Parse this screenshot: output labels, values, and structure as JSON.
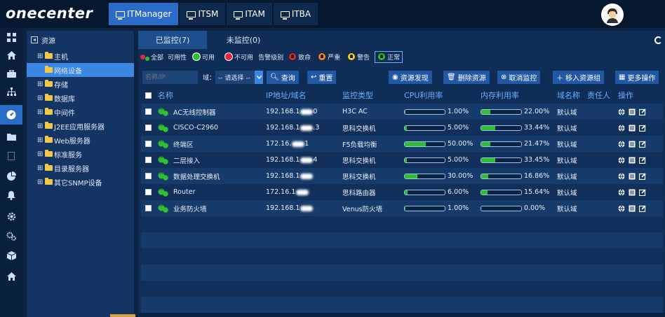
{
  "app": {
    "logo": "onecenter"
  },
  "topnav": [
    {
      "label": "ITManager",
      "active": true
    },
    {
      "label": "ITSM",
      "active": false
    },
    {
      "label": "ITAM",
      "active": false
    },
    {
      "label": "ITBA",
      "active": false
    }
  ],
  "rail_icons": [
    "grid-icon",
    "home-icon",
    "briefcase-icon",
    "hierarchy-icon",
    "gauge-icon",
    "folder-icon",
    "document-icon",
    "pie-chart-icon",
    "bell-icon",
    "gear-icon",
    "gears-icon",
    "cube-icon",
    "home-icon"
  ],
  "tree": {
    "root_label": "资源",
    "items": [
      {
        "label": "主机",
        "active": false
      },
      {
        "label": "网络设备",
        "active": true
      },
      {
        "label": "存储",
        "active": false
      },
      {
        "label": "数据库",
        "active": false
      },
      {
        "label": "中间件",
        "active": false
      },
      {
        "label": "J2EE应用服务器",
        "active": false
      },
      {
        "label": "Web服务器",
        "active": false
      },
      {
        "label": "标准服务",
        "active": false
      },
      {
        "label": "目录服务器",
        "active": false
      },
      {
        "label": "其它SNMP设备",
        "active": false
      }
    ]
  },
  "tabs": {
    "monitored": "已监控(7)",
    "unmonitored": "未监控(0)"
  },
  "legend": {
    "all": "全部",
    "availability": "可用性",
    "available": "可用",
    "unavailable": "不可用",
    "alarm_level": "告警级别",
    "fatal": "致命",
    "severe": "严重",
    "warning": "警告",
    "normal": "正常"
  },
  "toolbar": {
    "name_placeholder": "名称/IP",
    "domain_label": "域：",
    "domain_select": "-- 请选择 --",
    "query": "查询",
    "reset": "重置",
    "discover": "资源发现",
    "delete": "删除资源",
    "cancel_monitor": "取消监控",
    "move_group": "移入资源组",
    "more": "更多操作"
  },
  "table": {
    "headers": {
      "name": "名称",
      "ip": "IP地址/域名",
      "type": "监控类型",
      "cpu": "CPU利用率",
      "mem": "内存利用率",
      "domain": "域名称",
      "owner": "责任人",
      "ops": "操作"
    },
    "rows": [
      {
        "name": "AC无线控制器",
        "ip_prefix": "192.168.1",
        "ip_suffix": "0",
        "type": "H3C AC",
        "cpu": 1.0,
        "cpu_label": "1.00%",
        "mem": 22.0,
        "mem_label": "22.00%",
        "domain": "默认域"
      },
      {
        "name": "CISCO-C2960",
        "ip_prefix": "192.168.1",
        "ip_suffix": ".3",
        "type": "思科交换机",
        "cpu": 5.0,
        "cpu_label": "5.00%",
        "mem": 33.44,
        "mem_label": "33.44%",
        "domain": "默认域"
      },
      {
        "name": "终端区",
        "ip_prefix": "172.16.",
        "ip_suffix": "1",
        "type": "F5负载均衡",
        "cpu": 50.0,
        "cpu_label": "50.00%",
        "mem": 21.47,
        "mem_label": "21.47%",
        "domain": "默认域"
      },
      {
        "name": "二层接入",
        "ip_prefix": "192.168.1",
        "ip_suffix": "4",
        "type": "思科交换机",
        "cpu": 5.0,
        "cpu_label": "5.00%",
        "mem": 33.45,
        "mem_label": "33.45%",
        "domain": "默认域"
      },
      {
        "name": "数据处理交换机",
        "ip_prefix": "192.168.1",
        "ip_suffix": "",
        "type": "思科交换机",
        "cpu": 30.0,
        "cpu_label": "30.00%",
        "mem": 16.86,
        "mem_label": "16.86%",
        "domain": "默认域"
      },
      {
        "name": "Router",
        "ip_prefix": "172.16.1",
        "ip_suffix": "",
        "type": "思科路由器",
        "cpu": 6.0,
        "cpu_label": "6.00%",
        "mem": 15.64,
        "mem_label": "15.64%",
        "domain": "默认域"
      },
      {
        "name": "业务防火墙",
        "ip_prefix": "192.168.1",
        "ip_suffix": "",
        "type": "Venus防火墙",
        "cpu": 1.0,
        "cpu_label": "1.00%",
        "mem": 0.0,
        "mem_label": "0.00%",
        "domain": "默认域"
      }
    ]
  },
  "colors": {
    "accent": "#2a6cc7",
    "active_tree": "#3a86e0",
    "bar_fill": "#2ec02e",
    "header_text": "#6ab0ff",
    "status_green": "#2ec02e"
  }
}
